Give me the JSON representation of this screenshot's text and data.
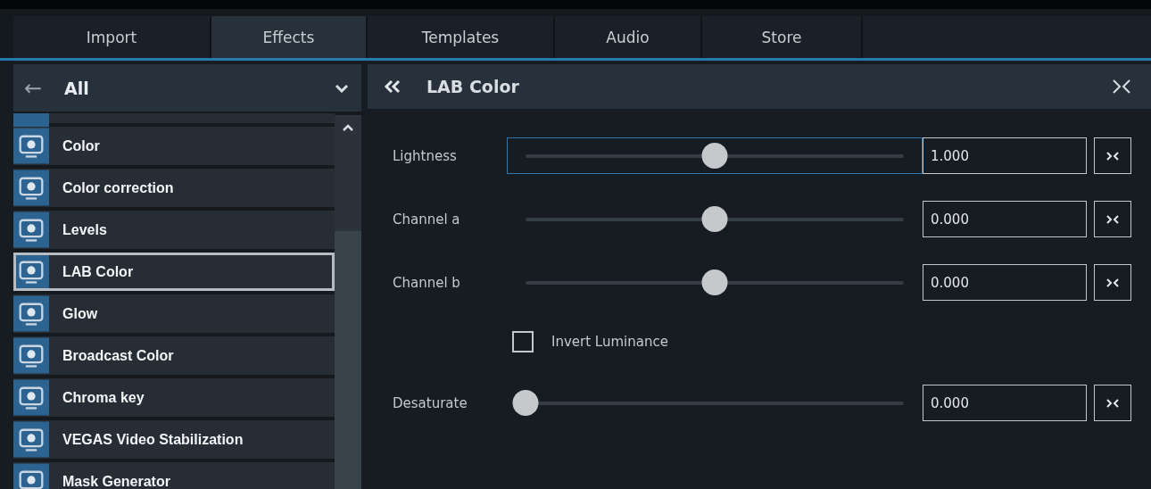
{
  "tabs": [
    {
      "label": "Import",
      "selected": false
    },
    {
      "label": "Effects",
      "selected": true
    },
    {
      "label": "Templates",
      "selected": false
    },
    {
      "label": "Audio",
      "selected": false
    },
    {
      "label": "Store",
      "selected": false
    }
  ],
  "sidebar": {
    "back": "←",
    "category": "All",
    "items": [
      {
        "label": "Color",
        "selected": false
      },
      {
        "label": "Color correction",
        "selected": false
      },
      {
        "label": "Levels",
        "selected": false
      },
      {
        "label": "LAB Color",
        "selected": true
      },
      {
        "label": "Glow",
        "selected": false
      },
      {
        "label": "Broadcast Color",
        "selected": false
      },
      {
        "label": "Chroma key",
        "selected": false
      },
      {
        "label": "VEGAS Video Stabilization",
        "selected": false
      },
      {
        "label": "Mask Generator",
        "selected": false
      }
    ]
  },
  "panel": {
    "title": "LAB Color",
    "controls": [
      {
        "kind": "slider",
        "label": "Lightness",
        "level": 0.5,
        "value": "1.000",
        "focused": true
      },
      {
        "kind": "slider",
        "label": "Channel a",
        "level": 0.5,
        "value": "0.000",
        "focused": false
      },
      {
        "kind": "slider",
        "label": "Channel b",
        "level": 0.5,
        "value": "0.000",
        "focused": false
      },
      {
        "kind": "checkbox",
        "label": "Invert Luminance",
        "checked": false
      },
      {
        "kind": "slider",
        "label": "Desaturate",
        "level": 0,
        "value": "0.000",
        "focused": false
      }
    ]
  }
}
